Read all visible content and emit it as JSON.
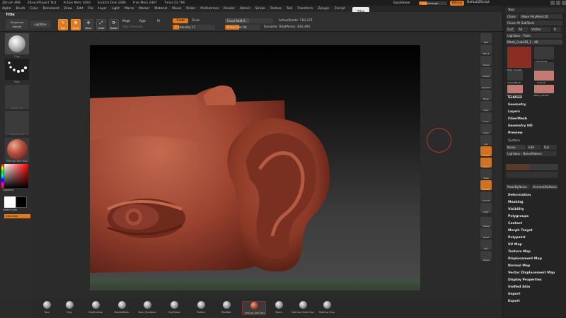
{
  "titlebar": {
    "app": "ZBrush 4R8",
    "project": "ZBrushProject Test",
    "active_mem": "Active Mem 1083",
    "scratch_disk": "Scratch Disk 2486",
    "free_mem": "Free Mem 2467",
    "timer": "Timer:23.796",
    "quicksave": "QuickSave",
    "see_through": "See-through",
    "see_through_value": 0.3,
    "menus": "Menus",
    "default_script": "DefaultZScript"
  },
  "menu": [
    "Alpha",
    "Brush",
    "Color",
    "Document",
    "Draw",
    "Edit",
    "File",
    "Layer",
    "Light",
    "Macro",
    "Marker",
    "Material",
    "Movie",
    "Picker",
    "Preferences",
    "Render",
    "Stencil",
    "Stroke",
    "Texture",
    "Tool",
    "Transform",
    "Zplugin",
    "Zscript"
  ],
  "title_tooltip": "Title",
  "toolbar": {
    "title": "Title",
    "projection_master": "Projection Master",
    "lightbox": "LightBox",
    "edit": "Edit",
    "draw": "Draw",
    "move": "Move",
    "scale": "Scale",
    "rotate": "Rotate",
    "mrgb": "Mrgb",
    "rgb": "Rgb",
    "m": "M",
    "rgb_intensity": "Rgb Intensity",
    "zadd": "Zadd",
    "zsub": "Zsub",
    "z_intensity": "Z Intensity 17",
    "focal_shift": "Focal Shift 0",
    "draw_size": "Draw Size 58",
    "dynamic": "Dynamic",
    "active_points": "ActivePoints: 783,471",
    "total_points": "TotalPoints: 816,491"
  },
  "left_shelf": {
    "brush_label": "Clay",
    "stroke_label": "Dots",
    "alpha_label": "Alpha Off",
    "texture_label": "Texture Off",
    "material_label": "MatCap Red Wax",
    "gradient": "Gradient",
    "switch_color": "SwitchColor",
    "alternate": "Alternate"
  },
  "right_strip": [
    "BPR",
    "SPix 3",
    "Actual",
    "AAHalf",
    "Dynamic",
    "Persp",
    "Floor",
    "Local",
    "LSym",
    "Xyz",
    "Frame",
    "Move",
    "Scale",
    "Rotate",
    "Line Fill",
    "PolyF",
    "Transp",
    "Ghost",
    "Solo",
    "Xpose"
  ],
  "tray": {
    "tool_header": "Tool",
    "clone": "Clone",
    "make_polymesh": "Make PolyMesh3D",
    "clone_all": "Clone All SubTools",
    "goz": "GoZ",
    "all": "All",
    "visible": "Visible",
    "r": "R",
    "lightbox_tools": "Lightbox › Tools",
    "current_tool": "Mesh_Cube30_1 . 48",
    "tiles": [
      "Mesh_Cube30",
      "Cylinder3D",
      "PolyMesh3D",
      "SimpleBrush",
      "Cube3D",
      "Mesh_Cube30",
      "Mesh_Cube30"
    ],
    "sections_a": [
      "Subtool",
      "Geometry",
      "Layers",
      "FiberMesh",
      "Geometry HD",
      "Preview"
    ],
    "surface": "Surface",
    "noise": "Noise",
    "edit": "Edit",
    "del": "Del",
    "lightbox_noisemakers": "Lightbox › NoiseMakers",
    "mask_by_noise": "MaskByNoise",
    "unmask_by_noise": "UnmaskByNoise",
    "sections_b": [
      "Deformation",
      "Masking",
      "Visibility",
      "Polygroups",
      "Contact",
      "Morph Target",
      "Polypaint",
      "UV Map",
      "Texture Map",
      "Displacement Map",
      "Normal Map",
      "Vector Displacement Map",
      "Display Properties",
      "Unified Skin",
      "Import",
      "Export"
    ]
  },
  "bottom_materials": [
    "Toon",
    "Clay",
    "ClayBuildup",
    "DoubleMesh",
    "Dam_Standard",
    "ClayTubes",
    "Flatten",
    "BlobDot",
    "MatCap Red Wax",
    "Move",
    "MatCap GreenClay",
    "MatCap Gray"
  ],
  "selected_material_index": 8,
  "colors": {
    "accent": "#e07a1e",
    "clay": "#a94a34",
    "tooltip": "#eaeaea"
  }
}
